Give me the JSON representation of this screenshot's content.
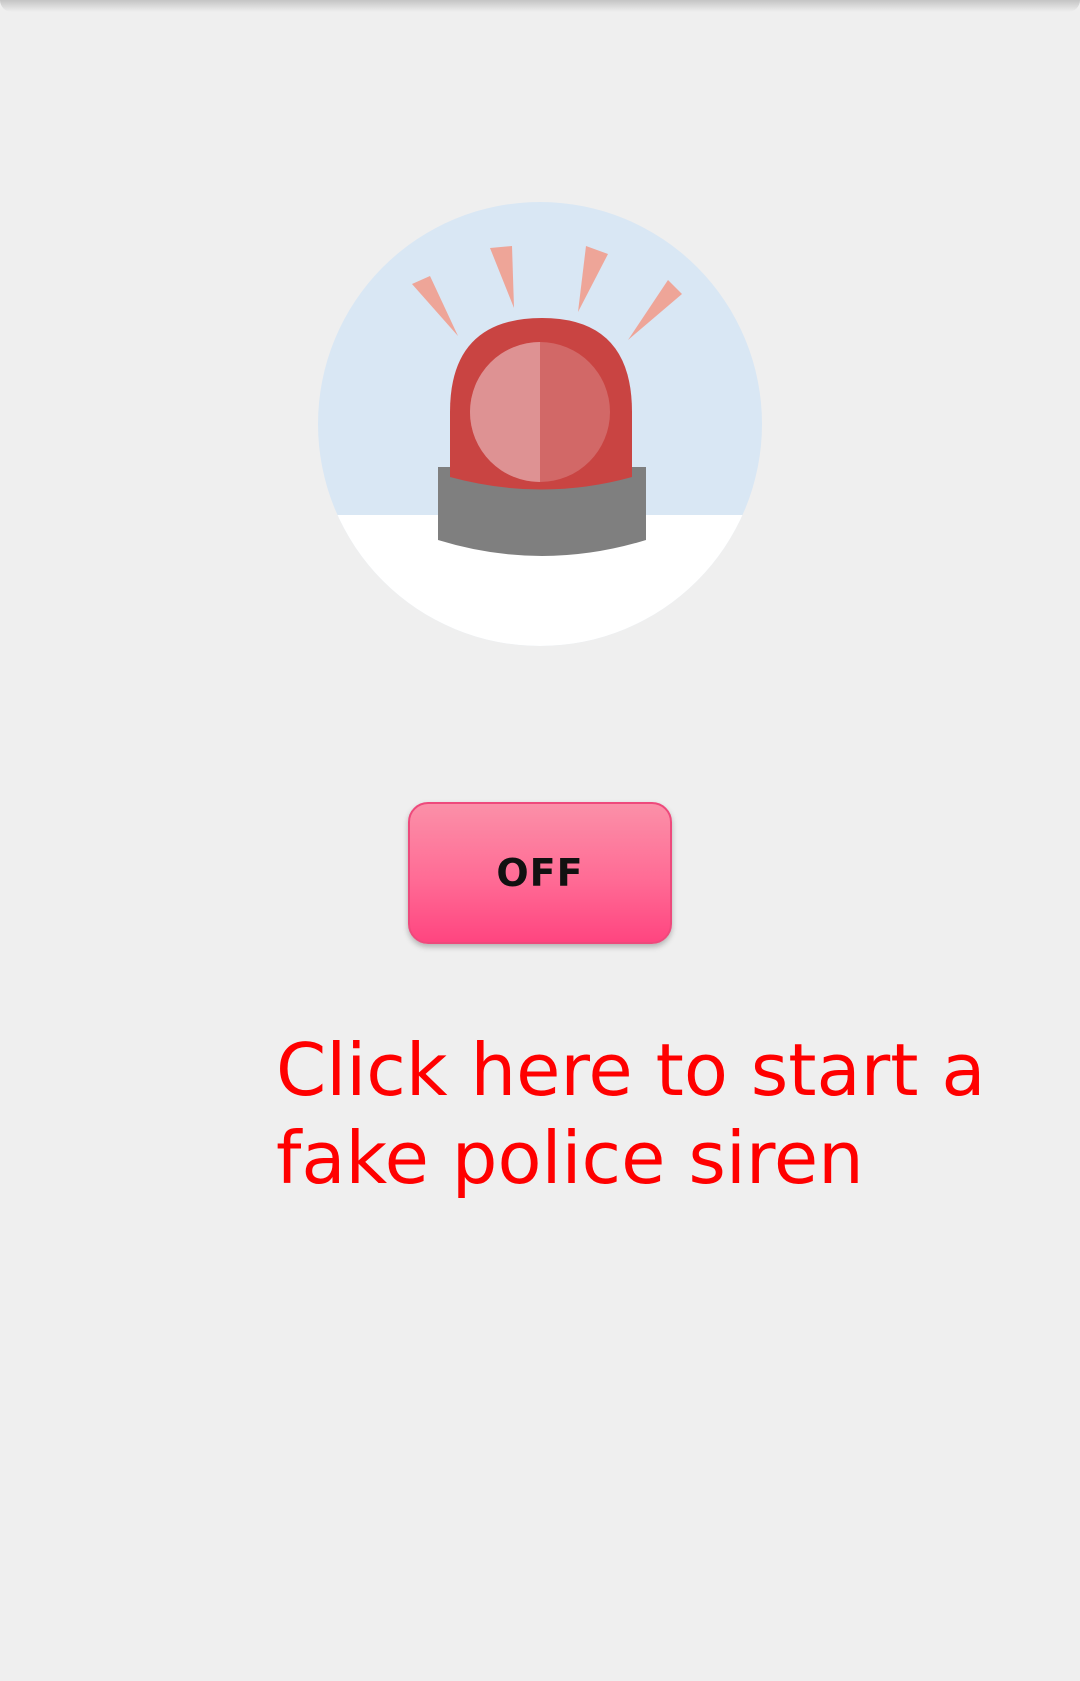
{
  "siren": {
    "icon": "police-siren-icon",
    "colors": {
      "circle_background": "#d9e7f4",
      "dome": "#c94442",
      "lens_left": "#de9293",
      "lens_right": "#d26867",
      "base": "#7f7f7f",
      "rays": "#eea598"
    }
  },
  "toggle": {
    "label": "OFF",
    "state": "off",
    "color_top": "#fb90a8",
    "color_bottom": "#ff4580"
  },
  "instruction": {
    "text": "Click here to start a fake police siren",
    "color": "#ff0000"
  }
}
